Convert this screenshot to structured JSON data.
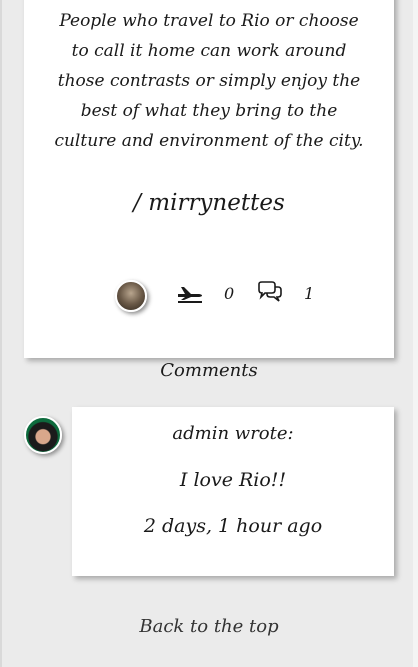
{
  "post": {
    "lines": [
      "People who travel to Rio or choose",
      "to call it home can work around",
      "those contrasts or simply enjoy the",
      "best of what they bring to the",
      "culture and environment of the city."
    ],
    "author": "/ mirrynettes",
    "like_count": "0",
    "comment_count": "1",
    "icons": {
      "like": "airplane-icon",
      "comment": "speech-bubbles-icon"
    }
  },
  "comments": {
    "heading": "Comments",
    "items": [
      {
        "author_line": "admin wrote:",
        "text": "I love Rio!!",
        "time": "2 days, 1 hour ago"
      }
    ]
  },
  "footer": {
    "back_to_top": "Back to the top"
  }
}
